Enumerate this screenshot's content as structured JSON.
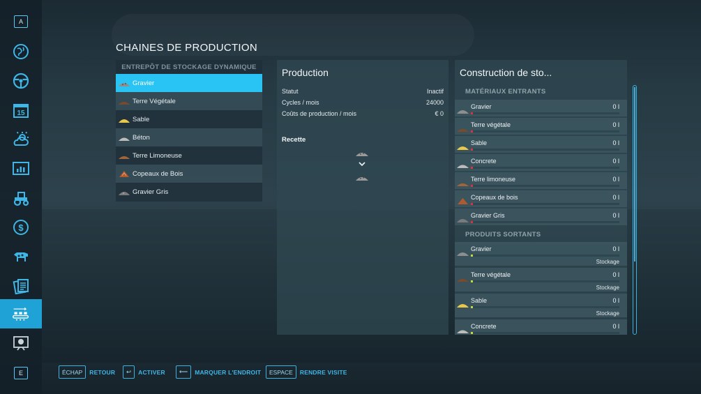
{
  "sidebar": {
    "top_key": "A",
    "bottom_key": "E",
    "items": [
      {
        "icon": "globe-icon"
      },
      {
        "icon": "steering-wheel-icon"
      },
      {
        "icon": "calendar-icon",
        "label": "15"
      },
      {
        "icon": "weather-icon"
      },
      {
        "icon": "statistics-icon"
      },
      {
        "icon": "tractor-icon"
      },
      {
        "icon": "finances-icon"
      },
      {
        "icon": "animals-icon"
      },
      {
        "icon": "contracts-icon"
      },
      {
        "icon": "production-icon",
        "active": true
      },
      {
        "icon": "help-icon"
      }
    ]
  },
  "page_title": "CHAINES DE PRODUCTION",
  "list": {
    "header": "ENTREPÔT DE STOCKAGE DYNAMIQUE",
    "items": [
      {
        "label": "Gravier",
        "icon": "gravel-icon",
        "selected": true
      },
      {
        "label": "Terre Végétale",
        "icon": "topsoil-icon"
      },
      {
        "label": "Sable",
        "icon": "sand-icon"
      },
      {
        "label": "Béton",
        "icon": "concrete-icon"
      },
      {
        "label": "Terre Limoneuse",
        "icon": "loam-icon"
      },
      {
        "label": "Copeaux de Bois",
        "icon": "woodchips-icon"
      },
      {
        "label": "Gravier Gris",
        "icon": "grey-gravel-icon"
      }
    ]
  },
  "production": {
    "title": "Production",
    "rows": [
      {
        "label": "Statut",
        "value": "Inactif"
      },
      {
        "label": "Cycles / mois",
        "value": "24000"
      },
      {
        "label": "Coûts de production / mois",
        "value": "€ 0"
      }
    ],
    "recipe_label": "Recette"
  },
  "details": {
    "title": "Construction de sto...",
    "inputs_header": "MATÉRIAUX ENTRANTS",
    "inputs": [
      {
        "name": "Gravier",
        "value": "0 l",
        "icon": "gravel-icon"
      },
      {
        "name": "Terre végétale",
        "value": "0 l",
        "icon": "topsoil-icon"
      },
      {
        "name": "Sable",
        "value": "0 l",
        "icon": "sand-icon"
      },
      {
        "name": "Concrete",
        "value": "0 l",
        "icon": "concrete-icon"
      },
      {
        "name": "Terre limoneuse",
        "value": "0 l",
        "icon": "loam-icon"
      },
      {
        "name": "Copeaux de bois",
        "value": "0 l",
        "icon": "woodchips-icon"
      },
      {
        "name": "Gravier Gris",
        "value": "0 l",
        "icon": "grey-gravel-icon"
      }
    ],
    "outputs_header": "PRODUITS SORTANTS",
    "outputs": [
      {
        "name": "Gravier",
        "value": "0 l",
        "mode": "Stockage",
        "icon": "gravel-icon"
      },
      {
        "name": "Terre végétale",
        "value": "0 l",
        "mode": "Stockage",
        "icon": "topsoil-icon"
      },
      {
        "name": "Sable",
        "value": "0 l",
        "mode": "Stockage",
        "icon": "sand-icon"
      },
      {
        "name": "Concrete",
        "value": "0 l",
        "icon": "concrete-icon"
      }
    ]
  },
  "bottom_hints": [
    {
      "key": "ÉCHAP",
      "label": "RETOUR"
    },
    {
      "key": "↩",
      "label": "ACTIVER"
    },
    {
      "key": "⟵",
      "label": "MARQUER L'ENDROIT"
    },
    {
      "key": "ESPACE",
      "label": "RENDRE VISITE"
    }
  ],
  "colors": {
    "accent": "#29c3f4",
    "input_level": "#e0303a",
    "output_level": "#c8d83a",
    "gravel": "#8e8e8e",
    "topsoil": "#7a4a2c",
    "sand": "#e8c84a",
    "concrete": "#bcbcbc",
    "loam": "#a0653a",
    "woodchips": "#b05a30"
  }
}
